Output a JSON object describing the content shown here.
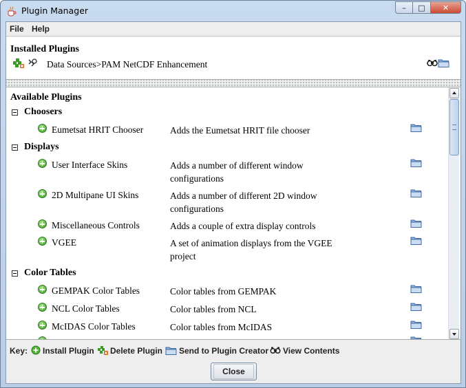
{
  "window": {
    "title": "Plugin Manager",
    "controls": {
      "minimize": "–",
      "maximize": "□",
      "close": "✕"
    }
  },
  "menubar": {
    "items": [
      "File",
      "Help"
    ]
  },
  "installed": {
    "title": "Installed Plugins",
    "items": [
      {
        "label": "Data Sources>PAM NetCDF Enhancement",
        "icons": [
          "delete-plugin-icon",
          "view-contents-icon",
          "view-contents-icon",
          "folder-icon"
        ]
      }
    ]
  },
  "available": {
    "title": "Available Plugins",
    "categories": [
      {
        "name": "Choosers",
        "plugins": [
          {
            "name": "Eumetsat HRIT Chooser",
            "description": "Adds the Eumetsat HRIT file chooser"
          }
        ]
      },
      {
        "name": "Displays",
        "plugins": [
          {
            "name": "User Interface Skins",
            "description": "Adds a number of different window configurations"
          },
          {
            "name": "2D Multipane UI Skins",
            "description": "Adds a number of different 2D window configurations"
          },
          {
            "name": "Miscellaneous Controls",
            "description": "Adds a couple of extra display controls"
          },
          {
            "name": "VGEE",
            "description": "A set of animation displays from the VGEE project"
          }
        ]
      },
      {
        "name": "Color Tables",
        "plugins": [
          {
            "name": "GEMPAK Color Tables",
            "description": "Color tables from GEMPAK"
          },
          {
            "name": "NCL Color Tables",
            "description": "Color tables from NCL"
          },
          {
            "name": "McIDAS Color Tables",
            "description": "Color tables from McIDAS"
          }
        ]
      }
    ]
  },
  "key": {
    "label": "Key:",
    "items": [
      {
        "icon": "install-plugin-icon",
        "label": "Install Plugin"
      },
      {
        "icon": "delete-plugin-icon",
        "label": "Delete Plugin"
      },
      {
        "icon": "folder-icon",
        "label": "Send to Plugin Creator"
      },
      {
        "icon": "view-contents-icon",
        "label": "View Contents"
      }
    ]
  },
  "buttons": {
    "close": "Close"
  },
  "colors": {
    "titlebar": "#c9dbee",
    "install_green": "#3e9a28",
    "folder_blue": "#5a86c0"
  }
}
